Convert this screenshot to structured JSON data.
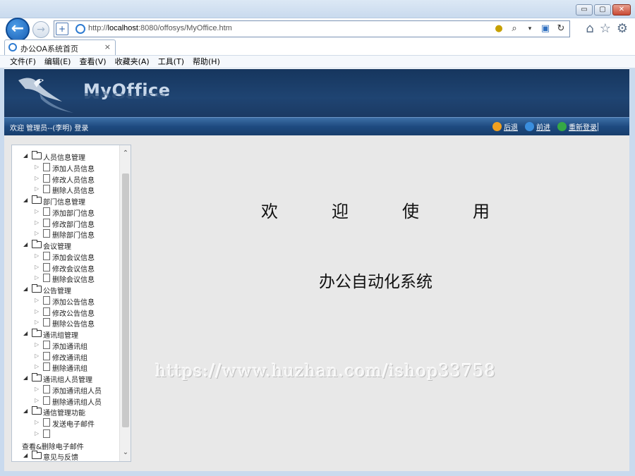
{
  "window": {
    "minimize": "▭",
    "maximize": "▢",
    "close": "✕"
  },
  "address": {
    "url_prefix": "http://",
    "url_host": "localhost",
    "url_rest": ":8080/offosys/MyOffice.htm"
  },
  "tab": {
    "title": "办公OA系统首页",
    "close": "×"
  },
  "menu": [
    "文件(F)",
    "编辑(E)",
    "查看(V)",
    "收藏夹(A)",
    "工具(T)",
    "帮助(H)"
  ],
  "banner": {
    "logo_text": "MyOffice"
  },
  "infobar": {
    "welcome": "欢迎 管理员--(李明) 登录",
    "back": "后退",
    "forward": "前进",
    "relogin": "重新登录",
    "back_color": "#f0a020",
    "forward_color": "#3a8ede",
    "relogin_color": "#35a845"
  },
  "tree": [
    {
      "type": "group",
      "label": "人员信息管理"
    },
    {
      "type": "leaf",
      "label": "添加人员信息"
    },
    {
      "type": "leaf",
      "label": "修改人员信息"
    },
    {
      "type": "leaf",
      "label": "删除人员信息"
    },
    {
      "type": "group",
      "label": "部门信息管理"
    },
    {
      "type": "leaf",
      "label": "添加部门信息"
    },
    {
      "type": "leaf",
      "label": "修改部门信息"
    },
    {
      "type": "leaf",
      "label": "删除部门信息"
    },
    {
      "type": "group",
      "label": "会议管理"
    },
    {
      "type": "leaf",
      "label": "添加会议信息"
    },
    {
      "type": "leaf",
      "label": "修改会议信息"
    },
    {
      "type": "leaf",
      "label": "删除会议信息"
    },
    {
      "type": "group",
      "label": "公告管理"
    },
    {
      "type": "leaf",
      "label": "添加公告信息"
    },
    {
      "type": "leaf",
      "label": "修改公告信息"
    },
    {
      "type": "leaf",
      "label": "删除公告信息"
    },
    {
      "type": "group",
      "label": "通讯组管理"
    },
    {
      "type": "leaf",
      "label": "添加通讯组"
    },
    {
      "type": "leaf",
      "label": "修改通讯组"
    },
    {
      "type": "leaf",
      "label": "删除通讯组"
    },
    {
      "type": "group",
      "label": "通讯组人员管理"
    },
    {
      "type": "leaf",
      "label": "添加通讯组人员"
    },
    {
      "type": "leaf",
      "label": "删除通讯组人员"
    },
    {
      "type": "group",
      "label": "通信管理功能"
    },
    {
      "type": "leaf",
      "label": "发送电子邮件"
    },
    {
      "type": "leaf",
      "label": ""
    },
    {
      "type": "plain",
      "label": "查看&删除电子邮件"
    },
    {
      "type": "group",
      "label": "意见与反馈"
    }
  ],
  "main": {
    "welcome": "欢迎使用",
    "system_name": "办公自动化系统",
    "watermark": "https://www.huzhan.com/ishop33758"
  }
}
